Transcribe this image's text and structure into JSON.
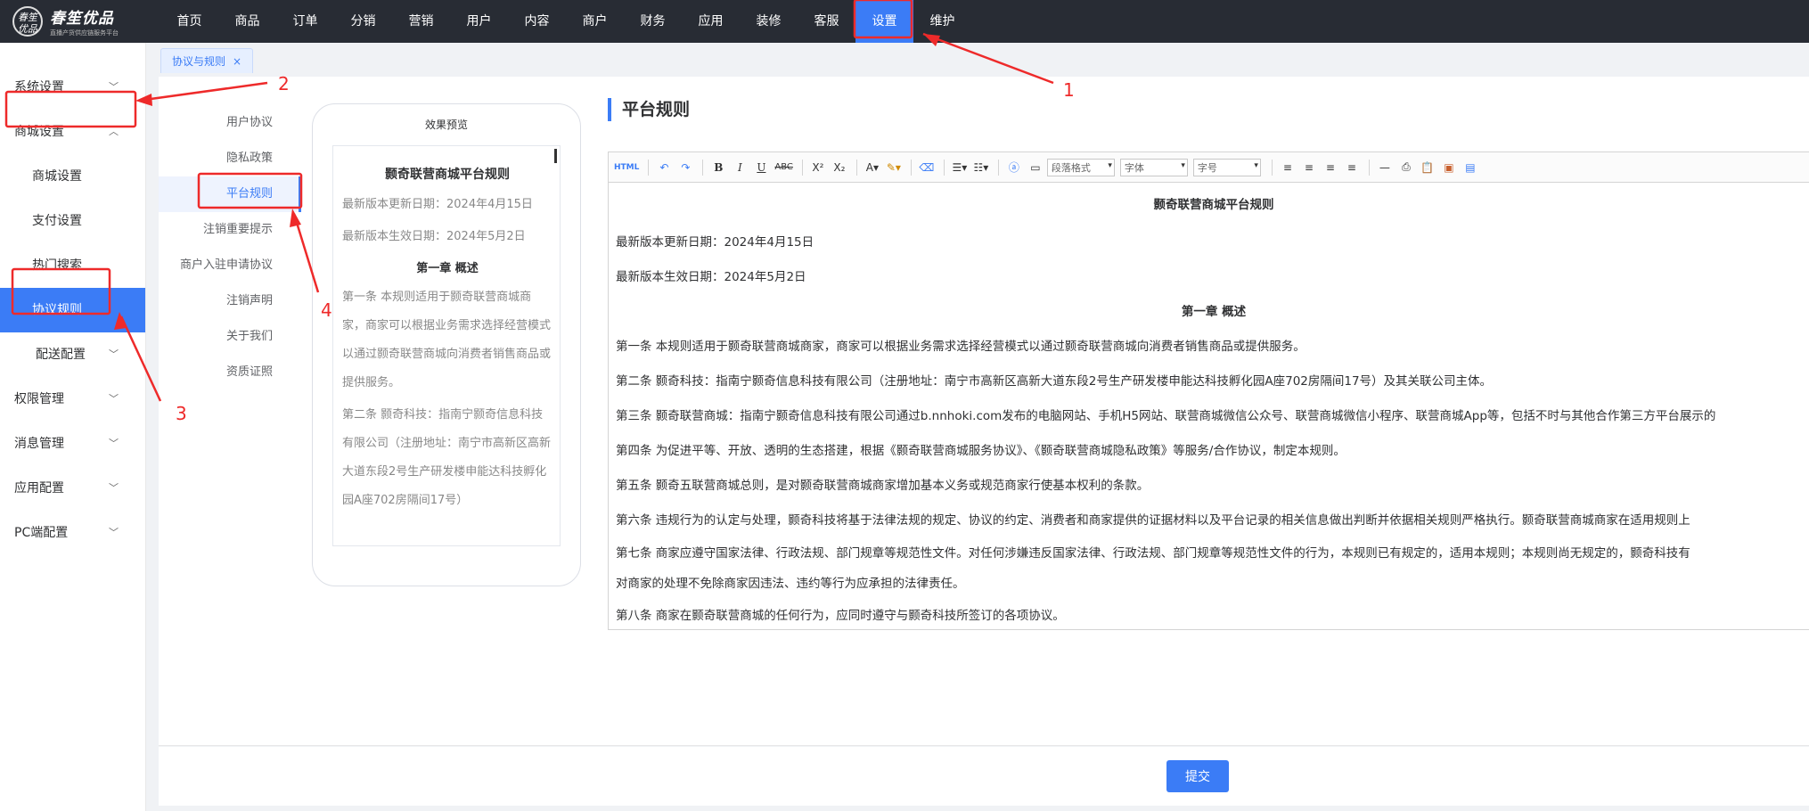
{
  "brand": {
    "logo_mark": "春笙\n优品",
    "name": "春笙优品",
    "tagline": "直播产货供应链服务平台"
  },
  "topnav": [
    {
      "label": "首页"
    },
    {
      "label": "商品"
    },
    {
      "label": "订单"
    },
    {
      "label": "分销"
    },
    {
      "label": "营销"
    },
    {
      "label": "用户"
    },
    {
      "label": "内容"
    },
    {
      "label": "商户"
    },
    {
      "label": "财务"
    },
    {
      "label": "应用"
    },
    {
      "label": "装修"
    },
    {
      "label": "客服"
    },
    {
      "label": "设置"
    },
    {
      "label": "维护"
    }
  ],
  "sidebar": {
    "groups": [
      {
        "label": "系统设置"
      },
      {
        "label": "商城设置"
      },
      {
        "label": "权限管理"
      },
      {
        "label": "消息管理"
      },
      {
        "label": "应用配置"
      },
      {
        "label": "PC端配置"
      }
    ],
    "mall_sub": [
      {
        "label": "商城设置"
      },
      {
        "label": "支付设置"
      },
      {
        "label": "热门搜索"
      },
      {
        "label": "协议规则"
      },
      {
        "label": "配送配置"
      }
    ]
  },
  "tab": {
    "label": "协议与规则",
    "close": "×"
  },
  "agreements": [
    {
      "label": "用户协议"
    },
    {
      "label": "隐私政策"
    },
    {
      "label": "平台规则"
    },
    {
      "label": "注销重要提示"
    },
    {
      "label": "商户入驻申请协议"
    },
    {
      "label": "注销声明"
    },
    {
      "label": "关于我们"
    },
    {
      "label": "资质证照"
    }
  ],
  "preview": {
    "label": "效果预览",
    "title": "颢奇联营商城平台规则",
    "paragraphs": [
      "最新版本更新日期：2024年4月15日",
      "最新版本生效日期：2024年5月2日"
    ],
    "chapter": "第一章 概述",
    "articles": [
      "第一条 本规则适用于颢奇联营商城商家，商家可以根据业务需求选择经营模式以通过颢奇联营商城向消费者销售商品或提供服务。",
      "第二条 颢奇科技：指南宁颢奇信息科技有限公司（注册地址：南宁市高新区高新大道东段2号生产研发楼申能达科技孵化园A座702房隔间17号）"
    ]
  },
  "editor": {
    "heading": "平台规则",
    "toolbar": {
      "html": "HTML",
      "paragraph_format": "段落格式",
      "font_family": "字体",
      "font_size": "字号"
    },
    "doc_title": "颢奇联营商城平台规则",
    "meta": [
      "最新版本更新日期：2024年4月15日",
      "最新版本生效日期：2024年5月2日"
    ],
    "chapter": "第一章 概述",
    "lines": [
      "第一条 本规则适用于颢奇联营商城商家，商家可以根据业务需求选择经营模式以通过颢奇联营商城向消费者销售商品或提供服务。",
      "第二条 颢奇科技：指南宁颢奇信息科技有限公司（注册地址：南宁市高新区高新大道东段2号生产研发楼申能达科技孵化园A座702房隔间17号）及其关联公司主体。",
      "第三条 颢奇联营商城：指南宁颢奇信息科技有限公司通过b.nnhoki.com发布的电脑网站、手机H5网站、联营商城微信公众号、联营商城微信小程序、联营商城App等，包括不时与其他合作第三方平台展示的",
      "第四条 为促进平等、开放、透明的生态搭建，根据《颢奇联营商城服务协议》、《颢奇联营商城隐私政策》等服务/合作协议，制定本规则。",
      "第五条 颢奇五联营商城总则，是对颢奇联营商城商家增加基本义务或规范商家行使基本权利的条款。",
      "第六条 违规行为的认定与处理，颢奇科技将基于法律法规的规定、协议的约定、消费者和商家提供的证据材料以及平台记录的相关信息做出判断并依据相关规则严格执行。颢奇联营商城商家在适用规则上",
      "第七条 商家应遵守国家法律、行政法规、部门规章等规范性文件。对任何涉嫌违反国家法律、行政法规、部门规章等规范性文件的行为，本规则已有规定的，适用本规则；本规则尚无规定的，颢奇科技有",
      "对商家的处理不免除商家因违法、违约等行为应承担的法律责任。",
      "第八条 商家在颢奇联营商城的任何行为，应同时遵守与颢奇科技所签订的各项协议。"
    ]
  },
  "submit_label": "提交",
  "annotations": {
    "labels": [
      "1",
      "2",
      "3",
      "4"
    ],
    "color": "#ee2a2a"
  },
  "colors": {
    "accent": "#3b7cf6",
    "topbar": "#282c34",
    "annotation": "#ee2a2a"
  }
}
